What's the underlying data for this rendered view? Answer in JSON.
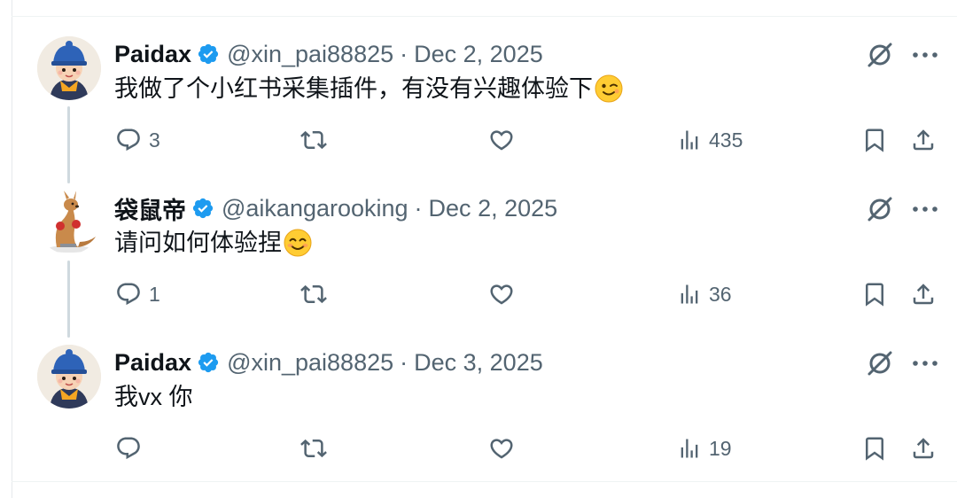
{
  "tweets": [
    {
      "author": "Paidax",
      "handle": "@xin_pai88825",
      "separator": "·",
      "date": "Dec 2, 2025",
      "text": "我做了个小红书采集插件，有没有兴趣体验下",
      "emoji": "winking-face",
      "avatar": "cartoon-boy-blue-hat",
      "replies": "3",
      "reposts": "",
      "likes": "",
      "views": "435"
    },
    {
      "author": "袋鼠帝",
      "handle": "@aikangarooking",
      "separator": "·",
      "date": "Dec 2, 2025",
      "text": "请问如何体验捏",
      "emoji": "smiling-face-with-smiling-eyes",
      "avatar": "kangaroo-boxer",
      "replies": "1",
      "reposts": "",
      "likes": "",
      "views": "36"
    },
    {
      "author": "Paidax",
      "handle": "@xin_pai88825",
      "separator": "·",
      "date": "Dec 3, 2025",
      "text": "我vx 你",
      "emoji": "",
      "avatar": "cartoon-boy-blue-hat",
      "replies": "",
      "reposts": "",
      "likes": "",
      "views": "19"
    }
  ],
  "icons": {
    "verified": "verified-badge-icon",
    "grok": "grok-icon",
    "more": "more-icon",
    "reply": "reply-icon",
    "repost": "repost-icon",
    "like": "like-icon",
    "views": "views-icon",
    "bookmark": "bookmark-icon",
    "share": "share-icon"
  },
  "colors": {
    "verified": "#1d9bf0",
    "text": "#0f1419",
    "secondary": "#536471",
    "thread_line": "#cfd9de"
  }
}
